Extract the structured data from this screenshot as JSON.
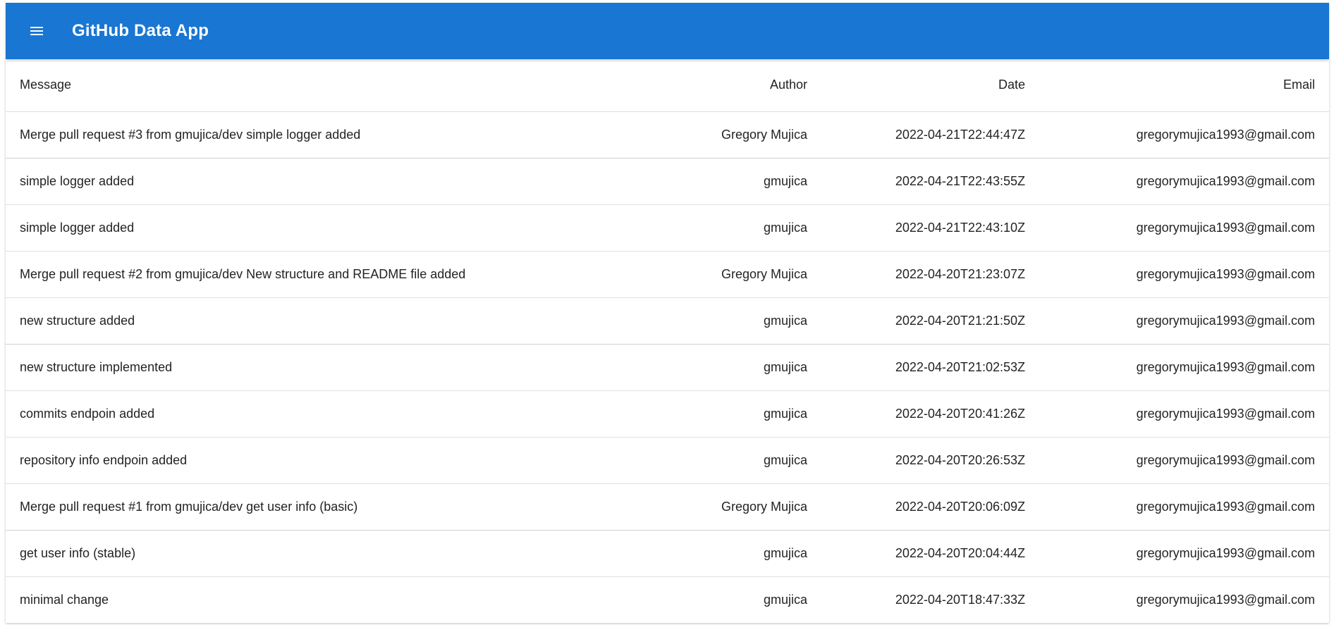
{
  "app": {
    "title": "GitHub Data App",
    "menu_icon": "menu-icon",
    "brand_color": "#1976d2"
  },
  "table": {
    "columns": [
      "Message",
      "Author",
      "Date",
      "Email"
    ],
    "rows": [
      {
        "message": "Merge pull request #3 from gmujica/dev simple logger added",
        "author": "Gregory Mujica",
        "date": "2022-04-21T22:44:47Z",
        "email": "gregorymujica1993@gmail.com"
      },
      {
        "message": "simple logger added",
        "author": "gmujica",
        "date": "2022-04-21T22:43:55Z",
        "email": "gregorymujica1993@gmail.com"
      },
      {
        "message": "simple logger added",
        "author": "gmujica",
        "date": "2022-04-21T22:43:10Z",
        "email": "gregorymujica1993@gmail.com"
      },
      {
        "message": "Merge pull request #2 from gmujica/dev New structure and README file added",
        "author": "Gregory Mujica",
        "date": "2022-04-20T21:23:07Z",
        "email": "gregorymujica1993@gmail.com"
      },
      {
        "message": "new structure added",
        "author": "gmujica",
        "date": "2022-04-20T21:21:50Z",
        "email": "gregorymujica1993@gmail.com"
      },
      {
        "message": "new structure implemented",
        "author": "gmujica",
        "date": "2022-04-20T21:02:53Z",
        "email": "gregorymujica1993@gmail.com"
      },
      {
        "message": "commits endpoin added",
        "author": "gmujica",
        "date": "2022-04-20T20:41:26Z",
        "email": "gregorymujica1993@gmail.com"
      },
      {
        "message": "repository info endpoin added",
        "author": "gmujica",
        "date": "2022-04-20T20:26:53Z",
        "email": "gregorymujica1993@gmail.com"
      },
      {
        "message": "Merge pull request #1 from gmujica/dev get user info (basic)",
        "author": "Gregory Mujica",
        "date": "2022-04-20T20:06:09Z",
        "email": "gregorymujica1993@gmail.com"
      },
      {
        "message": "get user info (stable)",
        "author": "gmujica",
        "date": "2022-04-20T20:04:44Z",
        "email": "gregorymujica1993@gmail.com"
      },
      {
        "message": "minimal change",
        "author": "gmujica",
        "date": "2022-04-20T18:47:33Z",
        "email": "gregorymujica1993@gmail.com"
      }
    ]
  }
}
